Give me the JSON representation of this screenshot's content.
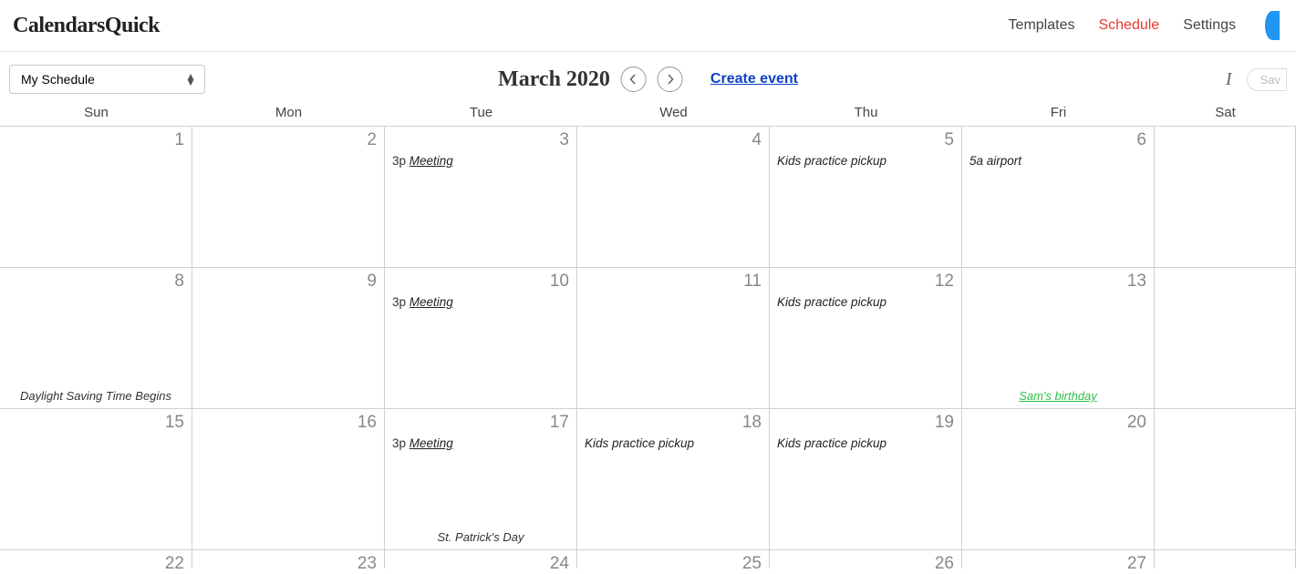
{
  "header": {
    "logo": "CalendarsQuick",
    "nav": {
      "templates": "Templates",
      "schedule": "Schedule",
      "settings": "Settings"
    }
  },
  "toolbar": {
    "schedule_select": "My Schedule",
    "month_title": "March 2020",
    "create_event": "Create event",
    "italic_label": "I",
    "save_label": "Sav"
  },
  "dayheaders": [
    "Sun",
    "Mon",
    "Tue",
    "Wed",
    "Thu",
    "Fri",
    "Sat"
  ],
  "weeks": [
    {
      "days": [
        {
          "num": "1",
          "events": [],
          "allday": null
        },
        {
          "num": "2",
          "events": [],
          "allday": null
        },
        {
          "num": "3",
          "events": [
            {
              "time": "3p",
              "title": "Meeting",
              "style": "link"
            }
          ],
          "allday": null
        },
        {
          "num": "4",
          "events": [],
          "allday": null
        },
        {
          "num": "5",
          "events": [
            {
              "time": "",
              "title": "Kids practice pickup",
              "style": "plain"
            }
          ],
          "allday": null
        },
        {
          "num": "6",
          "events": [
            {
              "time": "",
              "title": "5a airport",
              "style": "plain"
            }
          ],
          "allday": null
        },
        {
          "num": "",
          "events": [],
          "allday": null
        }
      ]
    },
    {
      "days": [
        {
          "num": "8",
          "events": [],
          "allday": {
            "text": "Daylight Saving Time Begins",
            "style": "normal"
          }
        },
        {
          "num": "9",
          "events": [],
          "allday": null
        },
        {
          "num": "10",
          "events": [
            {
              "time": "3p",
              "title": "Meeting",
              "style": "link"
            }
          ],
          "allday": null
        },
        {
          "num": "11",
          "events": [],
          "allday": null
        },
        {
          "num": "12",
          "events": [
            {
              "time": "",
              "title": "Kids practice pickup",
              "style": "plain"
            }
          ],
          "allday": null
        },
        {
          "num": "13",
          "events": [],
          "allday": {
            "text": "Sam's birthday",
            "style": "green"
          }
        },
        {
          "num": "",
          "events": [],
          "allday": null
        }
      ]
    },
    {
      "days": [
        {
          "num": "15",
          "events": [],
          "allday": null
        },
        {
          "num": "16",
          "events": [],
          "allday": null
        },
        {
          "num": "17",
          "events": [
            {
              "time": "3p",
              "title": "Meeting",
              "style": "link"
            }
          ],
          "allday": {
            "text": "St. Patrick's Day",
            "style": "normal"
          }
        },
        {
          "num": "18",
          "events": [
            {
              "time": "",
              "title": "Kids practice pickup",
              "style": "plain"
            }
          ],
          "allday": null
        },
        {
          "num": "19",
          "events": [
            {
              "time": "",
              "title": "Kids practice pickup",
              "style": "plain"
            }
          ],
          "allday": null
        },
        {
          "num": "20",
          "events": [],
          "allday": null
        },
        {
          "num": "",
          "events": [],
          "allday": null
        }
      ]
    },
    {
      "days": [
        {
          "num": "22",
          "events": [],
          "allday": null
        },
        {
          "num": "23",
          "events": [],
          "allday": null
        },
        {
          "num": "24",
          "events": [],
          "allday": null
        },
        {
          "num": "25",
          "events": [],
          "allday": null
        },
        {
          "num": "26",
          "events": [],
          "allday": null
        },
        {
          "num": "27",
          "events": [],
          "allday": null
        },
        {
          "num": "",
          "events": [],
          "allday": null
        }
      ]
    }
  ]
}
